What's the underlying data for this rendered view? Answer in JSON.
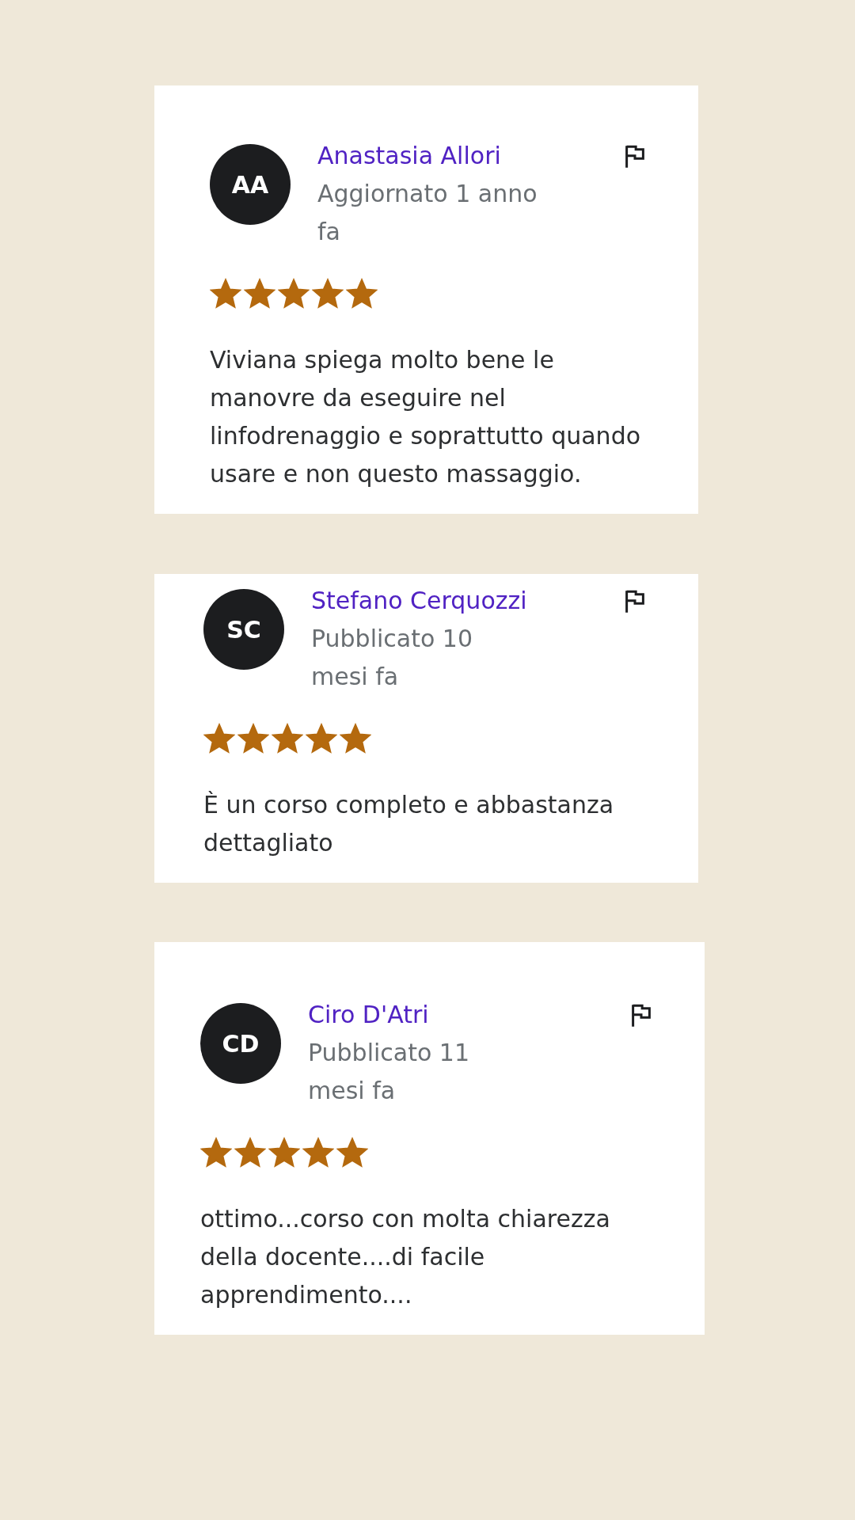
{
  "reviews": [
    {
      "initials": "AA",
      "name": "Anastasia Allori",
      "meta": "Aggiornato 1 anno fa",
      "stars": 5,
      "text": "Viviana spiega molto bene le manovre da eseguire nel linfodrenaggio e soprattutto quando usare e non questo massaggio."
    },
    {
      "initials": "SC",
      "name": "Stefano Cerquozzi",
      "meta": "Pubblicato 10 mesi fa",
      "stars": 5,
      "text": "È un corso completo e abbastanza dettagliato"
    },
    {
      "initials": "CD",
      "name": "Ciro D'Atri",
      "meta": "Pubblicato 11 mesi fa",
      "stars": 5,
      "text": "ottimo...corso con molta chiarezza della docente....di facile apprendimento...."
    }
  ]
}
